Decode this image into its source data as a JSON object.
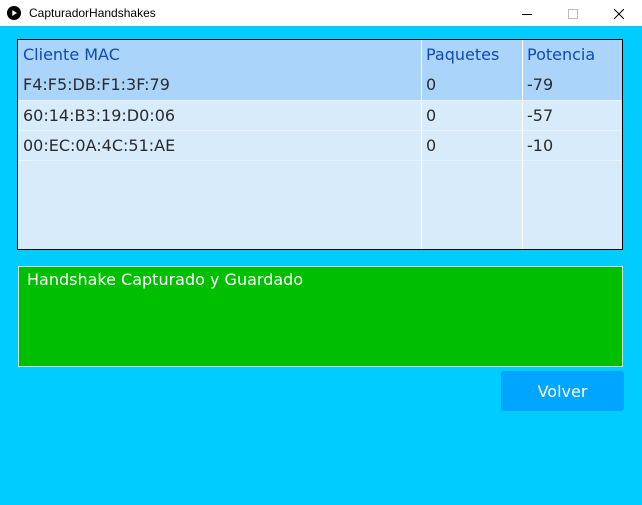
{
  "window": {
    "title": "CapturadorHandshakes",
    "controls": [
      "minimize-icon",
      "maximize-icon",
      "close-icon"
    ]
  },
  "table": {
    "headers": [
      "Cliente MAC",
      "Paquetes",
      "Potencia"
    ],
    "rows": [
      {
        "mac": "F4:F5:DB:F1:3F:79",
        "paquetes": "0",
        "potencia": "-79",
        "selected": true
      },
      {
        "mac": "60:14:B3:19:D0:06",
        "paquetes": "0",
        "potencia": "-57",
        "selected": false
      },
      {
        "mac": "00:EC:0A:4C:51:AE",
        "paquetes": "0",
        "potencia": "-10",
        "selected": false
      }
    ]
  },
  "status": {
    "message": "Handshake Capturado y Guardado"
  },
  "actions": {
    "volver_label": "Volver"
  },
  "colors": {
    "background": "#00ccff",
    "table_header": "#aad4fa",
    "table_body": "#d7ebfb",
    "header_text": "#1149b8",
    "message_bg": "#00bf00",
    "button_bg": "#00a5ff"
  }
}
